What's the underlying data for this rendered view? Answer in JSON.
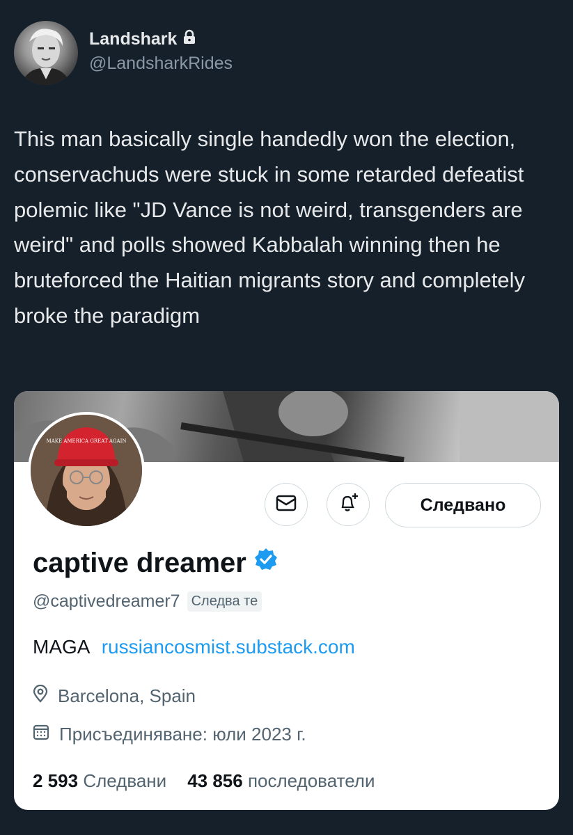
{
  "tweet": {
    "author_name": "Landshark",
    "author_handle": "@LandsharkRides",
    "locked_icon": "lock-icon",
    "text": "This man basically single handedly won the election, conservachuds were stuck in some retarded defeatist polemic like \"JD Vance is not weird, transgenders are weird\" and polls showed Kabbalah winning then he bruteforced the Haitian migrants story and completely broke the paradigm"
  },
  "profile_card": {
    "cap_text": "MAKE AMERICA GREAT AGAIN",
    "message_icon": "envelope-icon",
    "notify_icon": "bell-plus-icon",
    "follow_label": "Следвано",
    "display_name": "captive dreamer",
    "verified_icon": "verified-badge-icon",
    "handle": "@captivedreamer7",
    "follows_you": "Следва те",
    "bio_text": "MAGA",
    "bio_link": "russiancosmist.substack.com",
    "location_icon": "location-pin-icon",
    "location": "Barcelona, Spain",
    "joined_icon": "calendar-icon",
    "joined": "Присъединяване: юли 2023 г.",
    "following_count": "2 593",
    "following_label": "Следвани",
    "followers_count": "43 856",
    "followers_label": "последователи"
  },
  "colors": {
    "background": "#15202b",
    "accent": "#1d9bf0",
    "card_bg": "#ffffff"
  }
}
